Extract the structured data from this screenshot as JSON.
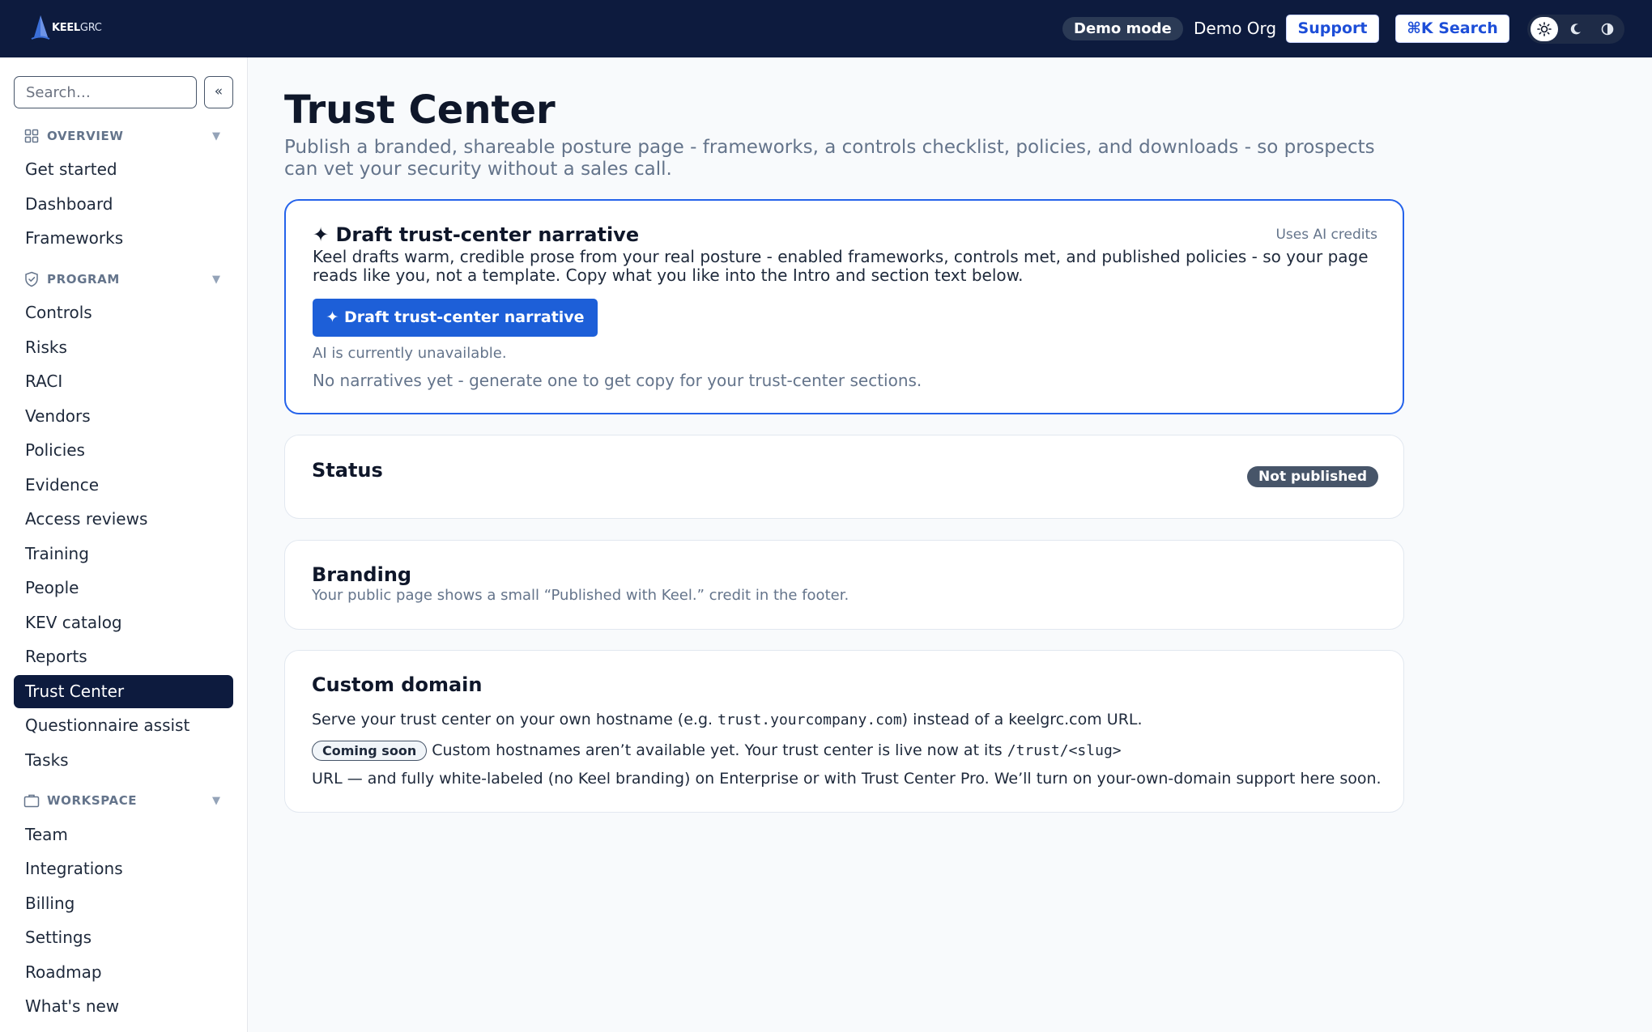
{
  "header": {
    "logo_text_bold": "KEEL",
    "logo_text_light": "GRC",
    "demo_mode_label": "Demo mode",
    "org_name": "Demo Org",
    "support_label": "Support",
    "search_label": "⌘K Search",
    "theme_options": [
      "light",
      "dark",
      "contrast"
    ],
    "theme_selected": "light"
  },
  "sidebar": {
    "search_placeholder": "Search…",
    "collapse_label": "«",
    "sections": [
      {
        "label": "OVERVIEW",
        "icon": "grid-icon",
        "items": [
          "Get started",
          "Dashboard",
          "Frameworks"
        ]
      },
      {
        "label": "PROGRAM",
        "icon": "shield-icon",
        "items": [
          "Controls",
          "Risks",
          "RACI",
          "Vendors",
          "Policies",
          "Evidence",
          "Access reviews",
          "Training",
          "People",
          "KEV catalog",
          "Reports",
          "Trust Center",
          "Questionnaire assist",
          "Tasks"
        ]
      },
      {
        "label": "WORKSPACE",
        "icon": "briefcase-icon",
        "items": [
          "Team",
          "Integrations",
          "Billing",
          "Settings",
          "Roadmap",
          "What's new"
        ]
      }
    ],
    "active_item": "Trust Center"
  },
  "main": {
    "title": "Trust Center",
    "subtitle": "Publish a branded, shareable posture page - frameworks, a controls checklist, policies, and downloads - so prospects can vet your security without a sales call.",
    "ai_card": {
      "title": "✦ Draft trust-center narrative",
      "credits_label": "Uses AI credits",
      "description": "Keel drafts warm, credible prose from your real posture - enabled frameworks, controls met, and published policies - so your page reads like you, not a template. Copy what you like into the Intro and section text below.",
      "button_label": "✦ Draft trust-center narrative",
      "unavailable_note": "AI is currently unavailable.",
      "empty_state": "No narratives yet - generate one to get copy for your trust-center sections."
    },
    "status_card": {
      "title": "Status",
      "badge": "Not published"
    },
    "branding_card": {
      "title": "Branding",
      "description": "Your public page shows a small “Published with Keel.” credit in the footer."
    },
    "domain_card": {
      "title": "Custom domain",
      "line1_before": "Serve your trust center on your own hostname (e.g. ",
      "line1_code": "trust.yourcompany.com",
      "line1_after": ") instead of a keelgrc.com URL.",
      "coming_soon_label": "Coming soon",
      "line2_text": "Custom hostnames aren’t available yet. Your trust center is live now at its ",
      "line2_code": "/trust/<slug>",
      "line3_text": "URL — and fully white-labeled (no Keel branding) on Enterprise or with Trust Center Pro. We’ll turn on your-own-domain support here soon."
    }
  },
  "colors": {
    "header_bg": "#0d1b3e",
    "accent": "#1d5fd8",
    "active_nav_bg": "#0d1b3e",
    "badge_bg": "#475569"
  }
}
